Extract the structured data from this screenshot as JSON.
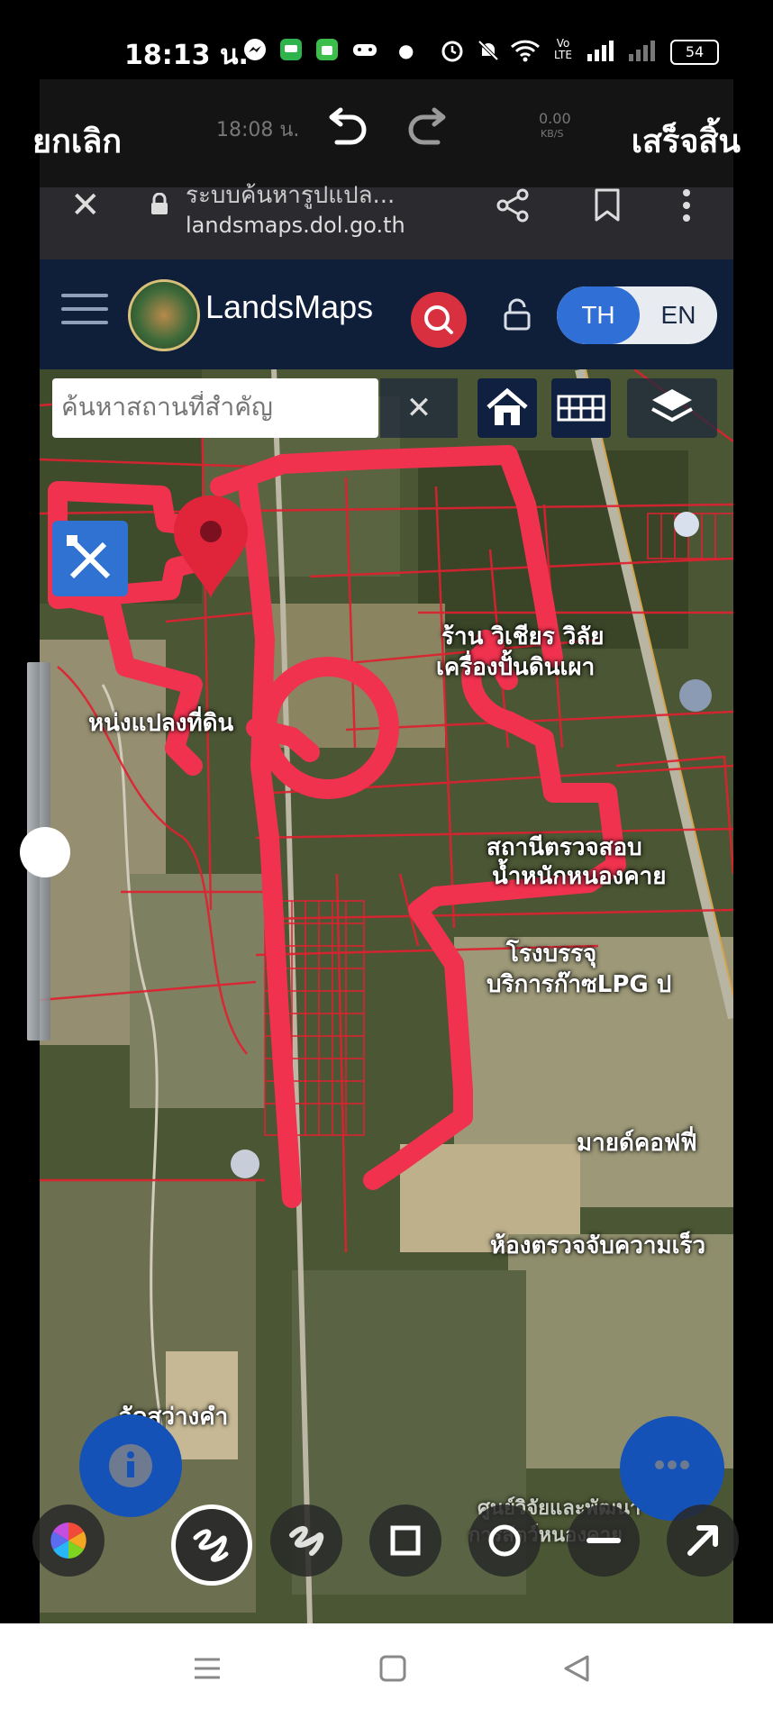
{
  "status_bar": {
    "time": "18:13 น.",
    "battery": "54"
  },
  "editor": {
    "cancel_label": "ยกเลิก",
    "done_label": "เสร็จสิ้น",
    "ghost_time": "18:08 น.",
    "ghost_speed": "0.00",
    "ghost_speed_unit": "KB/S"
  },
  "browser": {
    "page_title": "ระบบค้นหารูปแปล...",
    "url": "landsmaps.dol.go.th"
  },
  "landsmaps": {
    "brand": "LandsMaps",
    "lang_th": "TH",
    "lang_en": "EN"
  },
  "map": {
    "search_placeholder": "ค้นหาสถานที่สำคัญ",
    "clear_label": "✕",
    "labels": [
      "หน่งแปลงที่ดิน",
      "ร้าน วิเชียร วิลัย",
      "เครื่องปั้นดินเผา",
      "สถานีตรวจสอบ",
      "น้ำหนักหนองคาย",
      "โรงบรรจุ",
      "บริการก๊าซLPG ป",
      "มายด์คอฟฟี่",
      "ห้องตรวจจับความเร็ว",
      "วัดสว่างคำ",
      "ศูนย์วิจัยและพัฒนา",
      "การสัตว์หนองคาย"
    ]
  },
  "colors": {
    "accent_blue": "#2f6fd6",
    "brand_navy": "#0f1f3a",
    "search_red": "#d9303f",
    "drawing_pink": "#f0324f",
    "parcel_red": "#e02030"
  }
}
